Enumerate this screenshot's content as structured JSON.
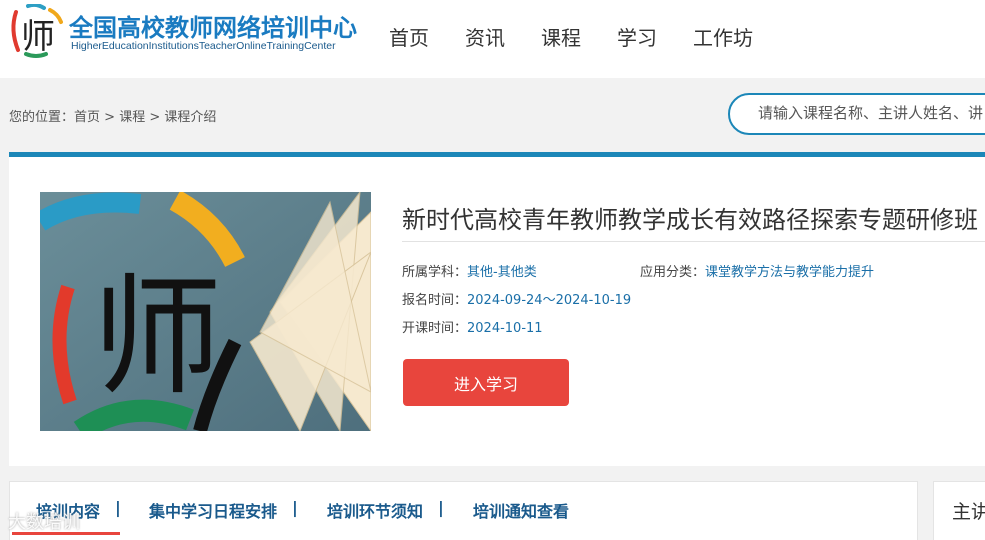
{
  "header": {
    "logo_title": "全国高校教师网络培训中心",
    "logo_subtitle": "HigherEducationInstitutionsTeacherOnlineTrainingCenter",
    "nav": [
      "首页",
      "资讯",
      "课程",
      "学习",
      "工作坊"
    ]
  },
  "breadcrumb": {
    "prefix": "您的位置：",
    "items": [
      "首页",
      "课程",
      "课程介绍"
    ],
    "separator": " > "
  },
  "search": {
    "placeholder": "请输入课程名称、主讲人姓名、讲"
  },
  "course": {
    "title": "新时代高校青年教师教学成长有效路径探索专题研修班",
    "subject_label": "所属学科：",
    "subject_value": "其他-其他类",
    "category_label": "应用分类：",
    "category_value": "课堂教学方法与教学能力提升",
    "enroll_label": "报名时间：",
    "enroll_value": "2024-09-24～2024-10-19",
    "start_label": "开课时间：",
    "start_value": "2024-10-11",
    "enter_button": "进入学习",
    "cover_char": "师"
  },
  "tabs": {
    "items": [
      "培训内容",
      "集中学习日程安排",
      "培训环节须知",
      "培训通知查看"
    ],
    "separator": "|",
    "active": "培训内容"
  },
  "side": {
    "title": "主讲"
  },
  "watermark": "大数培训",
  "colors": {
    "primary": "#1c87b8",
    "button": "#e8453d",
    "link": "#1a6fa8"
  }
}
